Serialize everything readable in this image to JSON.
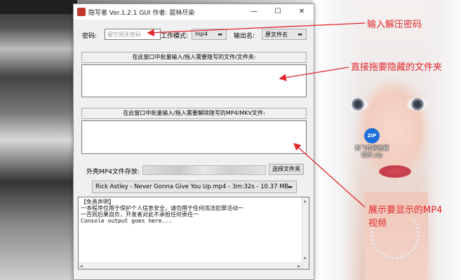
{
  "window": {
    "title": "隐写者 Ver.1.2.1 GUI 作者: 屈林尽染",
    "minimize_icon": "minimize-icon",
    "maximize_icon": "maximize-icon",
    "close_icon": "close-icon"
  },
  "form": {
    "password_label": "密码:",
    "password_placeholder": "留空则无密码",
    "mode_label": "工作模式:",
    "mode_value": "mp4",
    "output_label": "输出名:",
    "output_value": "原文件名",
    "hide_drop_title": "在此窗口中批量输入/拖入需要隐写的文件/文件夹:",
    "extract_drop_title": "在此窗口中批量输入/拖入需要解除隐写的MP4/MKV文件:",
    "shell_label": "外壳MP4文件存放:",
    "shell_path": "",
    "browse_button": "选择文件夹",
    "cover_video": "Rick Astley - Never Gonna Give You Up.mp4 - 3m:32s - 10.37 MB"
  },
  "console": {
    "lines": [
      "【免责声明】",
      "一本程序仅用于保护个人信息安全，请勿用于任何违法犯罪活动一",
      "一否则后果自负，开发者对此不承担任何责任一",
      "Console output goes here..."
    ]
  },
  "desktop": {
    "icon_label_1": "断飞传音隐藏",
    "icon_label_2": "软件.zip",
    "icon_badge": "ZIP"
  },
  "annotations": {
    "password": "输入解压密码",
    "drag_files": "直接拖要隐藏的文件夹",
    "mp4_line1": "展示要显示的MP4",
    "mp4_line2": "视频"
  },
  "colors": {
    "annotation": "#e3262b",
    "window_bg": "#f0f0f0"
  }
}
